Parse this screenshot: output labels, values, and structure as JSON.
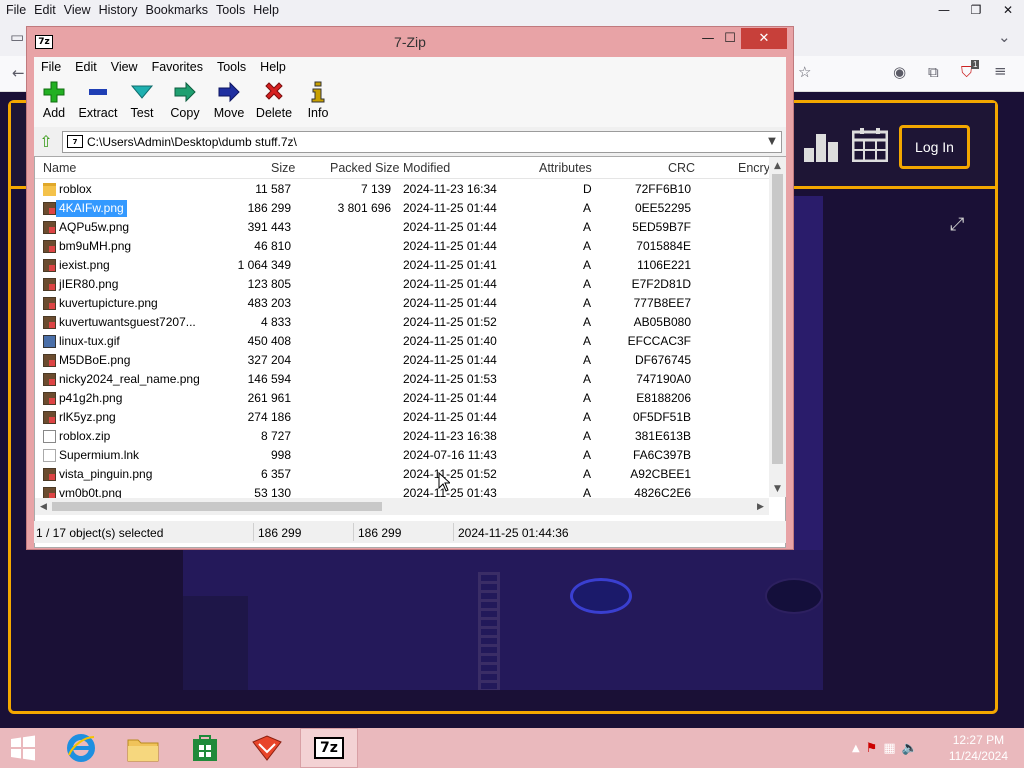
{
  "browser": {
    "menu": [
      {
        "label": "File"
      },
      {
        "label": "Edit"
      },
      {
        "label": "View"
      },
      {
        "label": "History"
      },
      {
        "label": "Bookmarks"
      },
      {
        "label": "Tools"
      },
      {
        "label": "Help"
      }
    ],
    "extension_badge": "1"
  },
  "site": {
    "login_label": "Log In"
  },
  "zip": {
    "title": "7-Zip",
    "logo": "7z",
    "menu": [
      "File",
      "Edit",
      "Favorites",
      "Tools",
      "Help"
    ],
    "toolbar": [
      {
        "label": "Add",
        "icon": "add-icon",
        "color": "#22b022"
      },
      {
        "label": "Extract",
        "icon": "extract-icon",
        "color": "#1f3fb5"
      },
      {
        "label": "Test",
        "icon": "test-icon",
        "color": "#1fb0b0"
      },
      {
        "label": "Copy",
        "icon": "copy-icon",
        "color": "#1f9f70"
      },
      {
        "label": "Move",
        "icon": "move-icon",
        "color": "#1f2fa0"
      },
      {
        "label": "Delete",
        "icon": "delete-icon",
        "color": "#d62020"
      },
      {
        "label": "Info",
        "icon": "info-icon",
        "color": "#c8a000"
      }
    ],
    "path": "C:\\Users\\Admin\\Desktop\\dumb stuff.7z\\",
    "columns": {
      "name": "Name",
      "size": "Size",
      "packed": "Packed Size",
      "modified": "Modified",
      "attributes": "Attributes",
      "crc": "CRC",
      "encrypted": "Encry"
    },
    "files": [
      {
        "name": "roblox",
        "icon": "folder-icon",
        "size": "11 587",
        "packed": "7 139",
        "modified": "2024-11-23 16:34",
        "attr": "D",
        "crc": "72FF6B10",
        "selected": false
      },
      {
        "name": "4KAIFw.png",
        "icon": "png-icon",
        "size": "186 299",
        "packed": "3 801 696",
        "modified": "2024-11-25 01:44",
        "attr": "A",
        "crc": "0EE52295",
        "selected": true
      },
      {
        "name": "AQPu5w.png",
        "icon": "png-icon",
        "size": "391 443",
        "packed": "",
        "modified": "2024-11-25 01:44",
        "attr": "A",
        "crc": "5ED59B7F",
        "selected": false
      },
      {
        "name": "bm9uMH.png",
        "icon": "png-icon",
        "size": "46 810",
        "packed": "",
        "modified": "2024-11-25 01:44",
        "attr": "A",
        "crc": "7015884E",
        "selected": false
      },
      {
        "name": "iexist.png",
        "icon": "png-icon",
        "size": "1 064 349",
        "packed": "",
        "modified": "2024-11-25 01:41",
        "attr": "A",
        "crc": "1106E221",
        "selected": false
      },
      {
        "name": "jIER80.png",
        "icon": "png-icon",
        "size": "123 805",
        "packed": "",
        "modified": "2024-11-25 01:44",
        "attr": "A",
        "crc": "E7F2D81D",
        "selected": false
      },
      {
        "name": "kuvertupicture.png",
        "icon": "png-icon",
        "size": "483 203",
        "packed": "",
        "modified": "2024-11-25 01:44",
        "attr": "A",
        "crc": "777B8EE7",
        "selected": false
      },
      {
        "name": "kuvertuwantsguest7207...",
        "icon": "png-icon",
        "size": "4 833",
        "packed": "",
        "modified": "2024-11-25 01:52",
        "attr": "A",
        "crc": "AB05B080",
        "selected": false
      },
      {
        "name": "linux-tux.gif",
        "icon": "gif-icon",
        "size": "450 408",
        "packed": "",
        "modified": "2024-11-25 01:40",
        "attr": "A",
        "crc": "EFCCAC3F",
        "selected": false
      },
      {
        "name": "M5DBoE.png",
        "icon": "png-icon",
        "size": "327 204",
        "packed": "",
        "modified": "2024-11-25 01:44",
        "attr": "A",
        "crc": "DF676745",
        "selected": false
      },
      {
        "name": "nicky2024_real_name.png",
        "icon": "png-icon",
        "size": "146 594",
        "packed": "",
        "modified": "2024-11-25 01:53",
        "attr": "A",
        "crc": "747190A0",
        "selected": false
      },
      {
        "name": "p41g2h.png",
        "icon": "png-icon",
        "size": "261 961",
        "packed": "",
        "modified": "2024-11-25 01:44",
        "attr": "A",
        "crc": "E8188206",
        "selected": false
      },
      {
        "name": "rlK5yz.png",
        "icon": "png-icon",
        "size": "274 186",
        "packed": "",
        "modified": "2024-11-25 01:44",
        "attr": "A",
        "crc": "0F5DF51B",
        "selected": false
      },
      {
        "name": "roblox.zip",
        "icon": "zip-icon",
        "size": "8 727",
        "packed": "",
        "modified": "2024-11-23 16:38",
        "attr": "A",
        "crc": "381E613B",
        "selected": false
      },
      {
        "name": "Supermium.lnk",
        "icon": "lnk-icon",
        "size": "998",
        "packed": "",
        "modified": "2024-07-16 11:43",
        "attr": "A",
        "crc": "FA6C397B",
        "selected": false
      },
      {
        "name": "vista_pinguin.png",
        "icon": "png-icon",
        "size": "6 357",
        "packed": "",
        "modified": "2024-11-25 01:52",
        "attr": "A",
        "crc": "A92CBEE1",
        "selected": false
      },
      {
        "name": "vm0b0t.png",
        "icon": "png-icon",
        "size": "53 130",
        "packed": "",
        "modified": "2024-11-25 01:43",
        "attr": "A",
        "crc": "4826C2E6",
        "selected": false
      }
    ],
    "status": {
      "selection": "1 / 17 object(s) selected",
      "size": "186 299",
      "packed": "186 299",
      "modified": "2024-11-25 01:44:36"
    }
  },
  "taskbar": {
    "apps": [
      {
        "name": "start-button",
        "icon": "windows-logo-icon"
      },
      {
        "name": "internet-explorer",
        "icon": "ie-icon"
      },
      {
        "name": "file-explorer",
        "icon": "folder-icon"
      },
      {
        "name": "store",
        "icon": "store-icon"
      },
      {
        "name": "browser-app",
        "icon": "fox-icon"
      },
      {
        "name": "7zip-app",
        "icon": "7zip-icon"
      }
    ],
    "time": "12:27 PM",
    "date": "11/24/2024"
  }
}
